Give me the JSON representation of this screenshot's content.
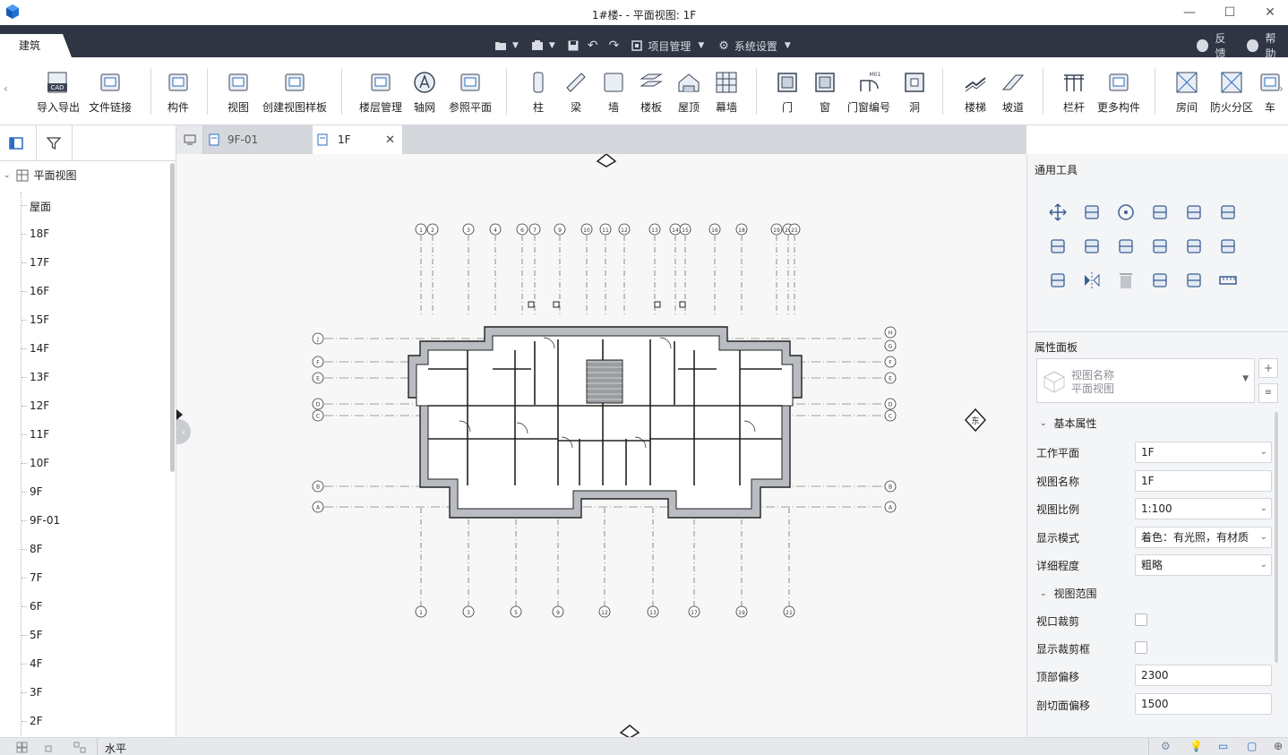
{
  "window": {
    "title": "1#楼- - 平面视图: 1F",
    "controls": {
      "minimize": "—",
      "maximize": "☐",
      "close": "✕"
    }
  },
  "menubar": {
    "active_tab": "建筑",
    "project_mgmt": "项目管理",
    "system_settings": "系统设置",
    "feedback": "反馈",
    "help": "帮助"
  },
  "ribbon": {
    "buttons": [
      {
        "label": "导入导出",
        "icon": "cad-import-icon"
      },
      {
        "label": "文件链接",
        "icon": "file-link-icon"
      },
      {
        "label": "构件",
        "icon": "component-icon"
      },
      {
        "label": "视图",
        "icon": "view-icon"
      },
      {
        "label": "创建视图样板",
        "icon": "view-template-icon"
      },
      {
        "label": "楼层管理",
        "icon": "floor-management-icon"
      },
      {
        "label": "轴网",
        "icon": "axis-grid-icon"
      },
      {
        "label": "参照平面",
        "icon": "reference-plane-icon"
      },
      {
        "label": "柱",
        "icon": "column-icon"
      },
      {
        "label": "梁",
        "icon": "beam-icon"
      },
      {
        "label": "墙",
        "icon": "wall-icon"
      },
      {
        "label": "楼板",
        "icon": "slab-icon"
      },
      {
        "label": "屋顶",
        "icon": "roof-icon"
      },
      {
        "label": "幕墙",
        "icon": "curtain-wall-icon"
      },
      {
        "label": "门",
        "icon": "door-icon"
      },
      {
        "label": "窗",
        "icon": "window-icon"
      },
      {
        "label": "门窗编号",
        "icon": "door-window-number-icon"
      },
      {
        "label": "洞",
        "icon": "opening-icon"
      },
      {
        "label": "楼梯",
        "icon": "stair-icon"
      },
      {
        "label": "坡道",
        "icon": "ramp-icon"
      },
      {
        "label": "栏杆",
        "icon": "railing-icon"
      },
      {
        "label": "更多构件",
        "icon": "more-components-icon"
      },
      {
        "label": "房间",
        "icon": "room-icon"
      },
      {
        "label": "防火分区",
        "icon": "fire-zone-icon"
      },
      {
        "label": "车",
        "icon": "vehicle-icon"
      }
    ],
    "cad_badge": "CAD",
    "m01_badge": "M01"
  },
  "left_panel": {
    "root": "平面视图",
    "levels": [
      "屋面",
      "18F",
      "17F",
      "16F",
      "15F",
      "14F",
      "13F",
      "12F",
      "11F",
      "10F",
      "9F",
      "9F-01",
      "8F",
      "7F",
      "6F",
      "5F",
      "4F",
      "3F",
      "2F"
    ]
  },
  "doc_tabs": [
    {
      "label": "9F-01",
      "active": false
    },
    {
      "label": "1F",
      "active": true
    }
  ],
  "canvas": {
    "compass_east": "东",
    "grid_top": [
      "1",
      "2",
      "3",
      "4",
      "6",
      "7",
      "9",
      "10",
      "11",
      "12",
      "13",
      "14",
      "15",
      "16",
      "18",
      "19",
      "20",
      "21"
    ],
    "grid_bottom": [
      "1",
      "3",
      "5",
      "9",
      "12",
      "13",
      "17",
      "19",
      "21"
    ],
    "grid_left": [
      "J",
      "F",
      "E",
      "D",
      "C",
      "B",
      "A"
    ],
    "grid_right": [
      "H",
      "G",
      "F",
      "E",
      "D",
      "C",
      "B",
      "A"
    ]
  },
  "right_panel": {
    "tools_title": "通用工具",
    "tool_icons": [
      "move-icon",
      "copy-icon",
      "rotate-icon",
      "align-top-icon",
      "align-center-icon",
      "align-vertical-icon",
      "array-icon",
      "align-left-icon",
      "trim-icon",
      "extend-icon",
      "split-icon",
      "offset-icon",
      "group-icon",
      "mirror-icon",
      "delete-icon",
      "3d-box-icon",
      "move-to-level-icon",
      "measure-icon"
    ],
    "props_title": "属性面板",
    "type_selector": {
      "name_label": "视图名称",
      "name_value": "平面视图"
    },
    "basic_section": "基本属性",
    "range_section": "视图范围",
    "props": [
      {
        "label": "工作平面",
        "value": "1F",
        "dropdown": true
      },
      {
        "label": "视图名称",
        "value": "1F",
        "dropdown": false
      },
      {
        "label": "视图比例",
        "value": "1:100",
        "dropdown": true
      },
      {
        "label": "显示模式",
        "value": "着色：有光照，有材质",
        "dropdown": true
      },
      {
        "label": "详细程度",
        "value": "粗略",
        "dropdown": true
      }
    ],
    "range_props": [
      {
        "label": "视口裁剪",
        "checked": false
      },
      {
        "label": "显示裁剪框",
        "checked": false
      }
    ],
    "offset_props": [
      {
        "label": "顶部偏移",
        "value": "2300"
      },
      {
        "label": "剖切面偏移",
        "value": "1500"
      }
    ]
  },
  "statusbar": {
    "mode": "水平"
  }
}
